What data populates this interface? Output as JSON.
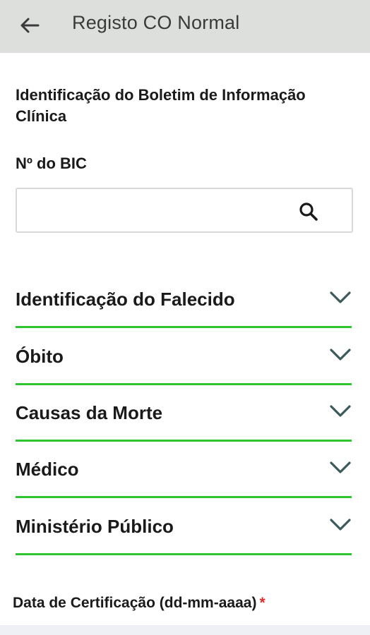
{
  "appbar": {
    "title": "Registo CO Normal",
    "back_icon": "arrow-left-icon",
    "background": "#dcdfdc"
  },
  "bic_section": {
    "title": "Identificação do Boletim de Informação Clínica",
    "field_label": "Nº do BIC",
    "input_value": "",
    "input_placeholder": "",
    "search_icon": "search-icon"
  },
  "accordions": [
    {
      "label": "Identificação do Falecido",
      "icon": "chevron-down-icon"
    },
    {
      "label": "Óbito",
      "icon": "chevron-down-icon"
    },
    {
      "label": "Causas da Morte",
      "icon": "chevron-down-icon"
    },
    {
      "label": "Médico",
      "icon": "chevron-down-icon"
    },
    {
      "label": "Ministério Público",
      "icon": "chevron-down-icon"
    }
  ],
  "date_field": {
    "label": "Data de Certificação (dd-mm-aaaa)",
    "required_marker": "*"
  },
  "colors": {
    "accent_line": "#2ec52e",
    "chevron": "#3d5a5a",
    "required": "#d93030"
  }
}
